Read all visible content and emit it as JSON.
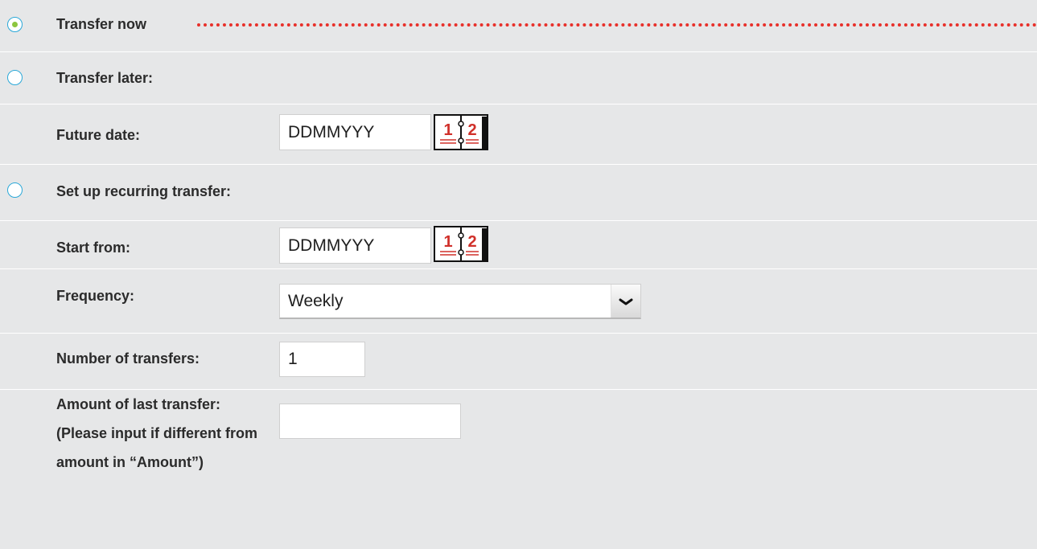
{
  "transfer_now": {
    "label": "Transfer now",
    "selected": true
  },
  "transfer_later": {
    "label": "Transfer later:",
    "selected": false,
    "future_date": {
      "label": "Future date:",
      "value": "DDMMYYY"
    }
  },
  "recurring": {
    "label": "Set up recurring transfer:",
    "selected": false,
    "start_from": {
      "label": "Start from:",
      "value": "DDMMYYY"
    },
    "frequency": {
      "label": "Frequency:",
      "value": "Weekly"
    },
    "number_of_transfers": {
      "label": "Number of transfers:",
      "value": "1"
    },
    "amount_of_last_transfer": {
      "label": "Amount of last transfer: (Please input if different from amount in “Amount”)",
      "value": ""
    }
  },
  "colors": {
    "background": "#e6e7e8",
    "radio_border": "#2aa8d8",
    "radio_selected_dot": "#8dc63f",
    "dotted_line": "#e8302a",
    "calendar_red": "#d0302a"
  },
  "icons": {
    "calendar": "calendar-icon",
    "dropdown": "chevron-down-icon"
  }
}
